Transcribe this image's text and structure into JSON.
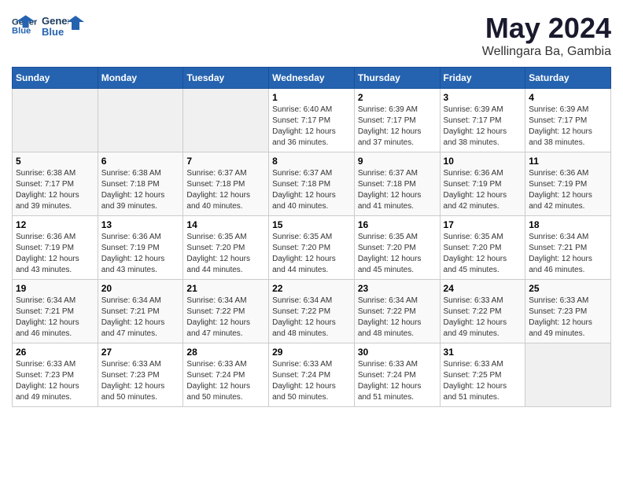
{
  "logo": {
    "line1": "General",
    "line2": "Blue"
  },
  "title": "May 2024",
  "subtitle": "Wellingara Ba, Gambia",
  "days_of_week": [
    "Sunday",
    "Monday",
    "Tuesday",
    "Wednesday",
    "Thursday",
    "Friday",
    "Saturday"
  ],
  "weeks": [
    [
      {
        "day": "",
        "info": ""
      },
      {
        "day": "",
        "info": ""
      },
      {
        "day": "",
        "info": ""
      },
      {
        "day": "1",
        "info": "Sunrise: 6:40 AM\nSunset: 7:17 PM\nDaylight: 12 hours\nand 36 minutes."
      },
      {
        "day": "2",
        "info": "Sunrise: 6:39 AM\nSunset: 7:17 PM\nDaylight: 12 hours\nand 37 minutes."
      },
      {
        "day": "3",
        "info": "Sunrise: 6:39 AM\nSunset: 7:17 PM\nDaylight: 12 hours\nand 38 minutes."
      },
      {
        "day": "4",
        "info": "Sunrise: 6:39 AM\nSunset: 7:17 PM\nDaylight: 12 hours\nand 38 minutes."
      }
    ],
    [
      {
        "day": "5",
        "info": "Sunrise: 6:38 AM\nSunset: 7:17 PM\nDaylight: 12 hours\nand 39 minutes."
      },
      {
        "day": "6",
        "info": "Sunrise: 6:38 AM\nSunset: 7:18 PM\nDaylight: 12 hours\nand 39 minutes."
      },
      {
        "day": "7",
        "info": "Sunrise: 6:37 AM\nSunset: 7:18 PM\nDaylight: 12 hours\nand 40 minutes."
      },
      {
        "day": "8",
        "info": "Sunrise: 6:37 AM\nSunset: 7:18 PM\nDaylight: 12 hours\nand 40 minutes."
      },
      {
        "day": "9",
        "info": "Sunrise: 6:37 AM\nSunset: 7:18 PM\nDaylight: 12 hours\nand 41 minutes."
      },
      {
        "day": "10",
        "info": "Sunrise: 6:36 AM\nSunset: 7:19 PM\nDaylight: 12 hours\nand 42 minutes."
      },
      {
        "day": "11",
        "info": "Sunrise: 6:36 AM\nSunset: 7:19 PM\nDaylight: 12 hours\nand 42 minutes."
      }
    ],
    [
      {
        "day": "12",
        "info": "Sunrise: 6:36 AM\nSunset: 7:19 PM\nDaylight: 12 hours\nand 43 minutes."
      },
      {
        "day": "13",
        "info": "Sunrise: 6:36 AM\nSunset: 7:19 PM\nDaylight: 12 hours\nand 43 minutes."
      },
      {
        "day": "14",
        "info": "Sunrise: 6:35 AM\nSunset: 7:20 PM\nDaylight: 12 hours\nand 44 minutes."
      },
      {
        "day": "15",
        "info": "Sunrise: 6:35 AM\nSunset: 7:20 PM\nDaylight: 12 hours\nand 44 minutes."
      },
      {
        "day": "16",
        "info": "Sunrise: 6:35 AM\nSunset: 7:20 PM\nDaylight: 12 hours\nand 45 minutes."
      },
      {
        "day": "17",
        "info": "Sunrise: 6:35 AM\nSunset: 7:20 PM\nDaylight: 12 hours\nand 45 minutes."
      },
      {
        "day": "18",
        "info": "Sunrise: 6:34 AM\nSunset: 7:21 PM\nDaylight: 12 hours\nand 46 minutes."
      }
    ],
    [
      {
        "day": "19",
        "info": "Sunrise: 6:34 AM\nSunset: 7:21 PM\nDaylight: 12 hours\nand 46 minutes."
      },
      {
        "day": "20",
        "info": "Sunrise: 6:34 AM\nSunset: 7:21 PM\nDaylight: 12 hours\nand 47 minutes."
      },
      {
        "day": "21",
        "info": "Sunrise: 6:34 AM\nSunset: 7:22 PM\nDaylight: 12 hours\nand 47 minutes."
      },
      {
        "day": "22",
        "info": "Sunrise: 6:34 AM\nSunset: 7:22 PM\nDaylight: 12 hours\nand 48 minutes."
      },
      {
        "day": "23",
        "info": "Sunrise: 6:34 AM\nSunset: 7:22 PM\nDaylight: 12 hours\nand 48 minutes."
      },
      {
        "day": "24",
        "info": "Sunrise: 6:33 AM\nSunset: 7:22 PM\nDaylight: 12 hours\nand 49 minutes."
      },
      {
        "day": "25",
        "info": "Sunrise: 6:33 AM\nSunset: 7:23 PM\nDaylight: 12 hours\nand 49 minutes."
      }
    ],
    [
      {
        "day": "26",
        "info": "Sunrise: 6:33 AM\nSunset: 7:23 PM\nDaylight: 12 hours\nand 49 minutes."
      },
      {
        "day": "27",
        "info": "Sunrise: 6:33 AM\nSunset: 7:23 PM\nDaylight: 12 hours\nand 50 minutes."
      },
      {
        "day": "28",
        "info": "Sunrise: 6:33 AM\nSunset: 7:24 PM\nDaylight: 12 hours\nand 50 minutes."
      },
      {
        "day": "29",
        "info": "Sunrise: 6:33 AM\nSunset: 7:24 PM\nDaylight: 12 hours\nand 50 minutes."
      },
      {
        "day": "30",
        "info": "Sunrise: 6:33 AM\nSunset: 7:24 PM\nDaylight: 12 hours\nand 51 minutes."
      },
      {
        "day": "31",
        "info": "Sunrise: 6:33 AM\nSunset: 7:25 PM\nDaylight: 12 hours\nand 51 minutes."
      },
      {
        "day": "",
        "info": ""
      }
    ]
  ]
}
